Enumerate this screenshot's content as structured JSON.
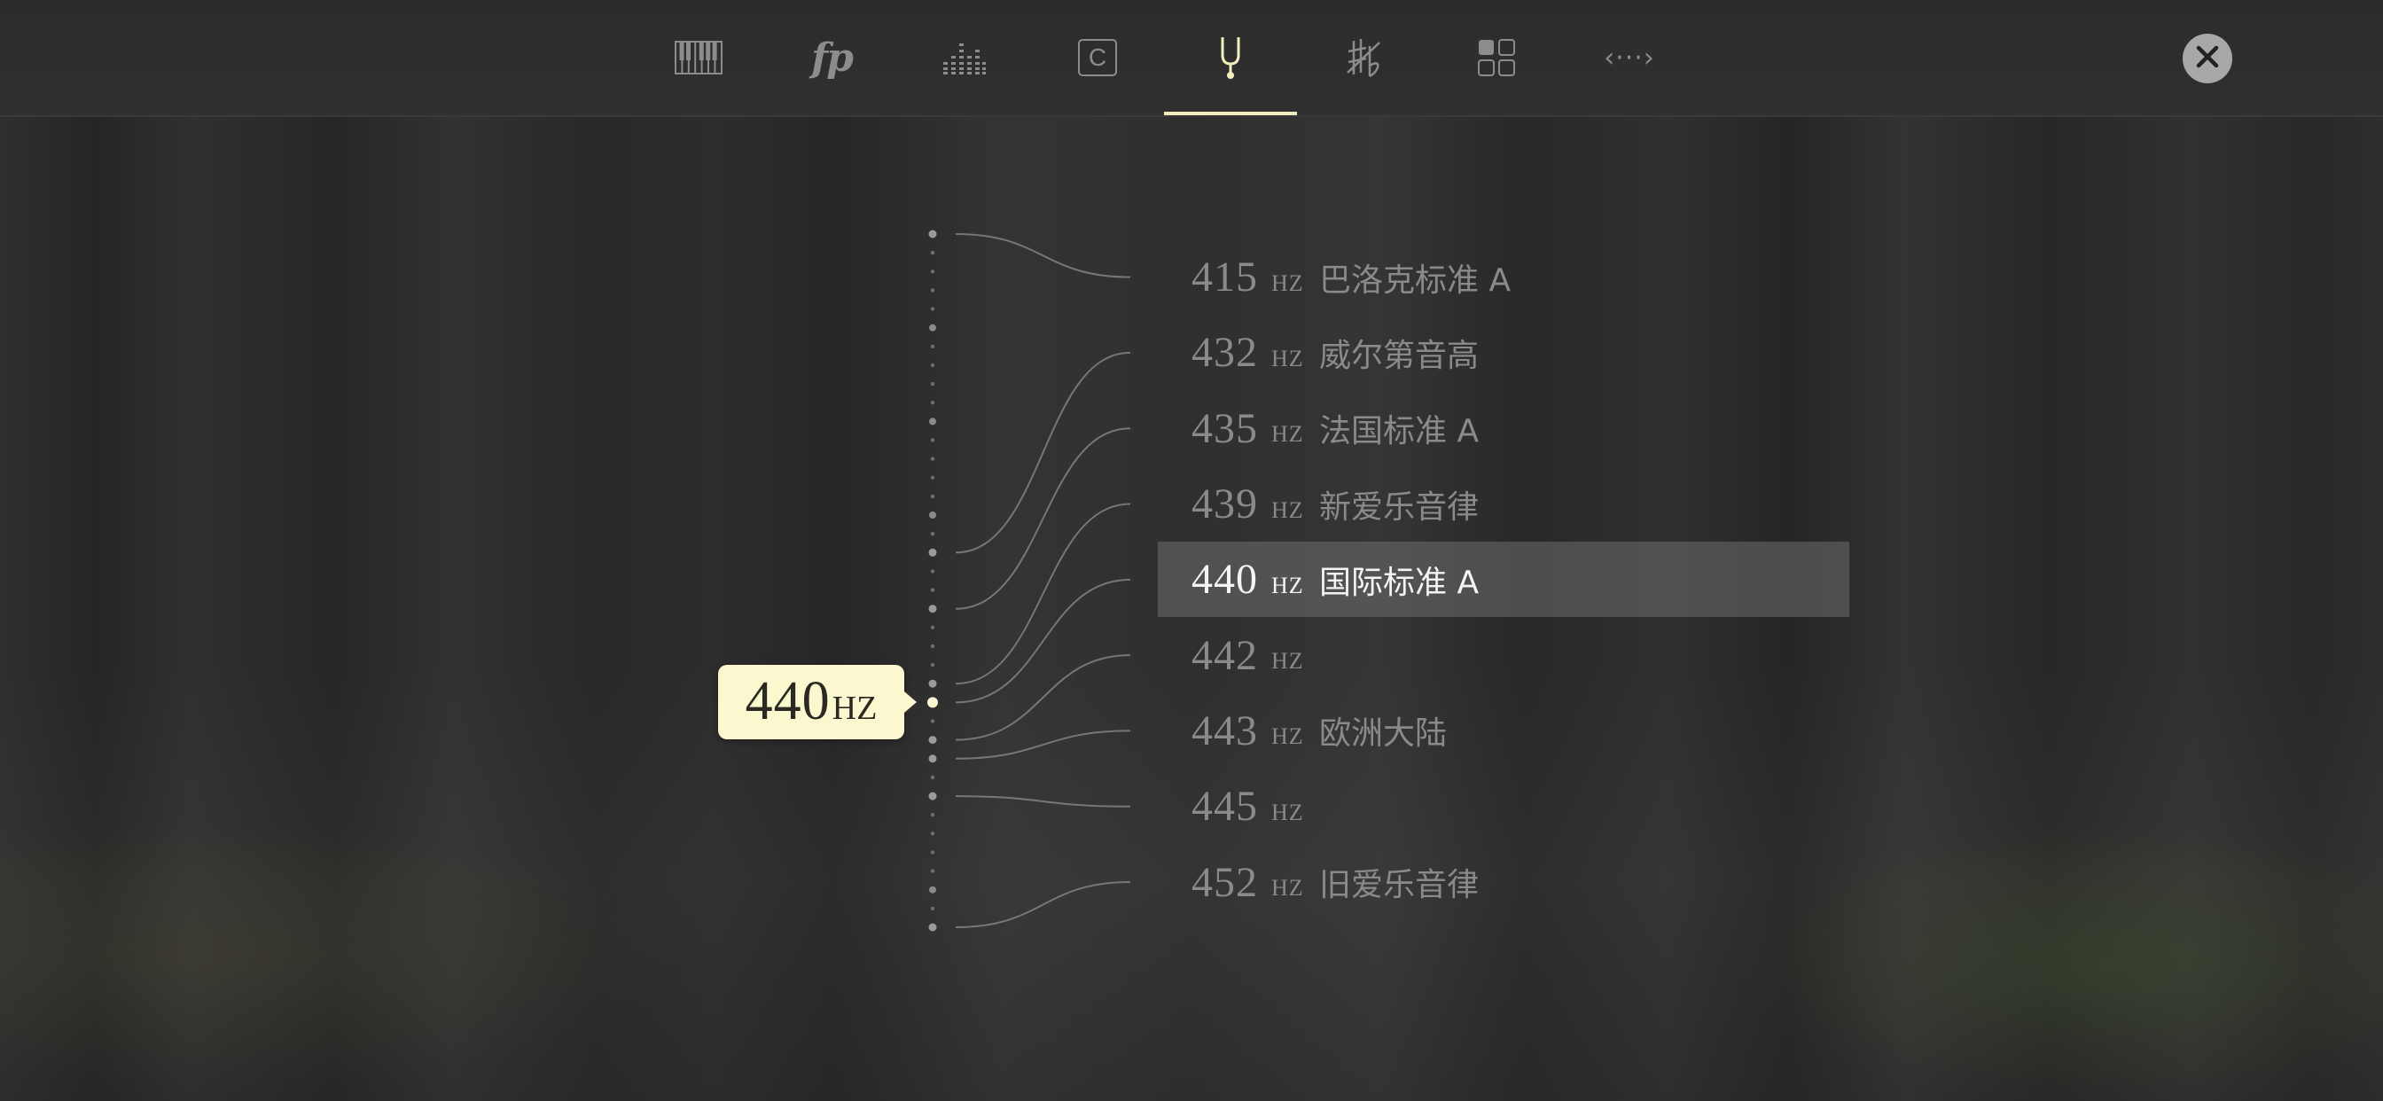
{
  "toolbar": {
    "items": [
      {
        "name": "keyboard-icon",
        "active": false
      },
      {
        "name": "dynamics-fp-icon",
        "label": "fp",
        "active": false
      },
      {
        "name": "equalizer-icon",
        "active": false
      },
      {
        "name": "key-c-icon",
        "label": "C",
        "active": false
      },
      {
        "name": "tuning-fork-icon",
        "active": true
      },
      {
        "name": "sharp-flat-icon",
        "active": false
      },
      {
        "name": "grid-icon",
        "active": false
      },
      {
        "name": "code-brackets-icon",
        "label": "‹···›",
        "active": false
      }
    ],
    "close_icon": "close-icon"
  },
  "pitch": {
    "current_value": "440",
    "current_unit": "HZ"
  },
  "presets": [
    {
      "freq": "415",
      "unit": "HZ",
      "name": "巴洛克标准 A",
      "selected": false
    },
    {
      "freq": "432",
      "unit": "HZ",
      "name": "威尔第音高",
      "selected": false
    },
    {
      "freq": "435",
      "unit": "HZ",
      "name": "法国标准 A",
      "selected": false
    },
    {
      "freq": "439",
      "unit": "HZ",
      "name": "新爱乐音律",
      "selected": false
    },
    {
      "freq": "440",
      "unit": "HZ",
      "name": "国际标准 A",
      "selected": true
    },
    {
      "freq": "442",
      "unit": "HZ",
      "name": "",
      "selected": false
    },
    {
      "freq": "443",
      "unit": "HZ",
      "name": "欧洲大陆",
      "selected": false
    },
    {
      "freq": "445",
      "unit": "HZ",
      "name": "",
      "selected": false
    },
    {
      "freq": "452",
      "unit": "HZ",
      "name": "旧爱乐音律",
      "selected": false
    }
  ],
  "colors": {
    "accent": "#f2efbf",
    "badge_bg": "#fbf7cf",
    "selected_row": "#5e5e5e",
    "text_dim": "#8a8a8a",
    "text_bright": "#f4f4f4"
  }
}
